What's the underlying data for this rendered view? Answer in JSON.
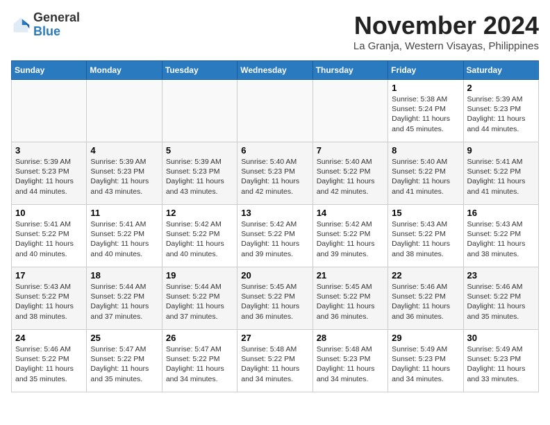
{
  "logo": {
    "general": "General",
    "blue": "Blue"
  },
  "title": "November 2024",
  "subtitle": "La Granja, Western Visayas, Philippines",
  "weekdays": [
    "Sunday",
    "Monday",
    "Tuesday",
    "Wednesday",
    "Thursday",
    "Friday",
    "Saturday"
  ],
  "weeks": [
    [
      {
        "day": "",
        "info": ""
      },
      {
        "day": "",
        "info": ""
      },
      {
        "day": "",
        "info": ""
      },
      {
        "day": "",
        "info": ""
      },
      {
        "day": "",
        "info": ""
      },
      {
        "day": "1",
        "info": "Sunrise: 5:38 AM\nSunset: 5:24 PM\nDaylight: 11 hours and 45 minutes."
      },
      {
        "day": "2",
        "info": "Sunrise: 5:39 AM\nSunset: 5:23 PM\nDaylight: 11 hours and 44 minutes."
      }
    ],
    [
      {
        "day": "3",
        "info": "Sunrise: 5:39 AM\nSunset: 5:23 PM\nDaylight: 11 hours and 44 minutes."
      },
      {
        "day": "4",
        "info": "Sunrise: 5:39 AM\nSunset: 5:23 PM\nDaylight: 11 hours and 43 minutes."
      },
      {
        "day": "5",
        "info": "Sunrise: 5:39 AM\nSunset: 5:23 PM\nDaylight: 11 hours and 43 minutes."
      },
      {
        "day": "6",
        "info": "Sunrise: 5:40 AM\nSunset: 5:23 PM\nDaylight: 11 hours and 42 minutes."
      },
      {
        "day": "7",
        "info": "Sunrise: 5:40 AM\nSunset: 5:22 PM\nDaylight: 11 hours and 42 minutes."
      },
      {
        "day": "8",
        "info": "Sunrise: 5:40 AM\nSunset: 5:22 PM\nDaylight: 11 hours and 41 minutes."
      },
      {
        "day": "9",
        "info": "Sunrise: 5:41 AM\nSunset: 5:22 PM\nDaylight: 11 hours and 41 minutes."
      }
    ],
    [
      {
        "day": "10",
        "info": "Sunrise: 5:41 AM\nSunset: 5:22 PM\nDaylight: 11 hours and 40 minutes."
      },
      {
        "day": "11",
        "info": "Sunrise: 5:41 AM\nSunset: 5:22 PM\nDaylight: 11 hours and 40 minutes."
      },
      {
        "day": "12",
        "info": "Sunrise: 5:42 AM\nSunset: 5:22 PM\nDaylight: 11 hours and 40 minutes."
      },
      {
        "day": "13",
        "info": "Sunrise: 5:42 AM\nSunset: 5:22 PM\nDaylight: 11 hours and 39 minutes."
      },
      {
        "day": "14",
        "info": "Sunrise: 5:42 AM\nSunset: 5:22 PM\nDaylight: 11 hours and 39 minutes."
      },
      {
        "day": "15",
        "info": "Sunrise: 5:43 AM\nSunset: 5:22 PM\nDaylight: 11 hours and 38 minutes."
      },
      {
        "day": "16",
        "info": "Sunrise: 5:43 AM\nSunset: 5:22 PM\nDaylight: 11 hours and 38 minutes."
      }
    ],
    [
      {
        "day": "17",
        "info": "Sunrise: 5:43 AM\nSunset: 5:22 PM\nDaylight: 11 hours and 38 minutes."
      },
      {
        "day": "18",
        "info": "Sunrise: 5:44 AM\nSunset: 5:22 PM\nDaylight: 11 hours and 37 minutes."
      },
      {
        "day": "19",
        "info": "Sunrise: 5:44 AM\nSunset: 5:22 PM\nDaylight: 11 hours and 37 minutes."
      },
      {
        "day": "20",
        "info": "Sunrise: 5:45 AM\nSunset: 5:22 PM\nDaylight: 11 hours and 36 minutes."
      },
      {
        "day": "21",
        "info": "Sunrise: 5:45 AM\nSunset: 5:22 PM\nDaylight: 11 hours and 36 minutes."
      },
      {
        "day": "22",
        "info": "Sunrise: 5:46 AM\nSunset: 5:22 PM\nDaylight: 11 hours and 36 minutes."
      },
      {
        "day": "23",
        "info": "Sunrise: 5:46 AM\nSunset: 5:22 PM\nDaylight: 11 hours and 35 minutes."
      }
    ],
    [
      {
        "day": "24",
        "info": "Sunrise: 5:46 AM\nSunset: 5:22 PM\nDaylight: 11 hours and 35 minutes."
      },
      {
        "day": "25",
        "info": "Sunrise: 5:47 AM\nSunset: 5:22 PM\nDaylight: 11 hours and 35 minutes."
      },
      {
        "day": "26",
        "info": "Sunrise: 5:47 AM\nSunset: 5:22 PM\nDaylight: 11 hours and 34 minutes."
      },
      {
        "day": "27",
        "info": "Sunrise: 5:48 AM\nSunset: 5:22 PM\nDaylight: 11 hours and 34 minutes."
      },
      {
        "day": "28",
        "info": "Sunrise: 5:48 AM\nSunset: 5:23 PM\nDaylight: 11 hours and 34 minutes."
      },
      {
        "day": "29",
        "info": "Sunrise: 5:49 AM\nSunset: 5:23 PM\nDaylight: 11 hours and 34 minutes."
      },
      {
        "day": "30",
        "info": "Sunrise: 5:49 AM\nSunset: 5:23 PM\nDaylight: 11 hours and 33 minutes."
      }
    ]
  ]
}
